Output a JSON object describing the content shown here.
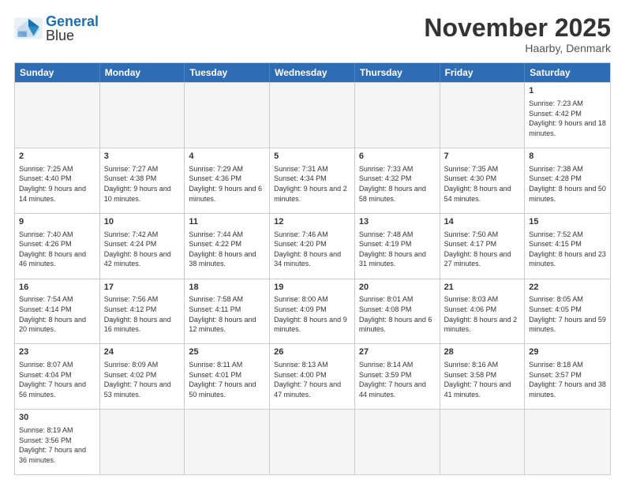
{
  "header": {
    "logo_general": "General",
    "logo_blue": "Blue",
    "month_title": "November 2025",
    "location": "Haarby, Denmark"
  },
  "days_of_week": [
    "Sunday",
    "Monday",
    "Tuesday",
    "Wednesday",
    "Thursday",
    "Friday",
    "Saturday"
  ],
  "weeks": [
    [
      {
        "day": "",
        "empty": true
      },
      {
        "day": "",
        "empty": true
      },
      {
        "day": "",
        "empty": true
      },
      {
        "day": "",
        "empty": true
      },
      {
        "day": "",
        "empty": true
      },
      {
        "day": "",
        "empty": true
      },
      {
        "day": "1",
        "sunrise": "7:23 AM",
        "sunset": "4:42 PM",
        "daylight": "9 hours and 18 minutes."
      }
    ],
    [
      {
        "day": "2",
        "sunrise": "7:25 AM",
        "sunset": "4:40 PM",
        "daylight": "9 hours and 14 minutes."
      },
      {
        "day": "3",
        "sunrise": "7:27 AM",
        "sunset": "4:38 PM",
        "daylight": "9 hours and 10 minutes."
      },
      {
        "day": "4",
        "sunrise": "7:29 AM",
        "sunset": "4:36 PM",
        "daylight": "9 hours and 6 minutes."
      },
      {
        "day": "5",
        "sunrise": "7:31 AM",
        "sunset": "4:34 PM",
        "daylight": "9 hours and 2 minutes."
      },
      {
        "day": "6",
        "sunrise": "7:33 AM",
        "sunset": "4:32 PM",
        "daylight": "8 hours and 58 minutes."
      },
      {
        "day": "7",
        "sunrise": "7:35 AM",
        "sunset": "4:30 PM",
        "daylight": "8 hours and 54 minutes."
      },
      {
        "day": "8",
        "sunrise": "7:38 AM",
        "sunset": "4:28 PM",
        "daylight": "8 hours and 50 minutes."
      }
    ],
    [
      {
        "day": "9",
        "sunrise": "7:40 AM",
        "sunset": "4:26 PM",
        "daylight": "8 hours and 46 minutes."
      },
      {
        "day": "10",
        "sunrise": "7:42 AM",
        "sunset": "4:24 PM",
        "daylight": "8 hours and 42 minutes."
      },
      {
        "day": "11",
        "sunrise": "7:44 AM",
        "sunset": "4:22 PM",
        "daylight": "8 hours and 38 minutes."
      },
      {
        "day": "12",
        "sunrise": "7:46 AM",
        "sunset": "4:20 PM",
        "daylight": "8 hours and 34 minutes."
      },
      {
        "day": "13",
        "sunrise": "7:48 AM",
        "sunset": "4:19 PM",
        "daylight": "8 hours and 31 minutes."
      },
      {
        "day": "14",
        "sunrise": "7:50 AM",
        "sunset": "4:17 PM",
        "daylight": "8 hours and 27 minutes."
      },
      {
        "day": "15",
        "sunrise": "7:52 AM",
        "sunset": "4:15 PM",
        "daylight": "8 hours and 23 minutes."
      }
    ],
    [
      {
        "day": "16",
        "sunrise": "7:54 AM",
        "sunset": "4:14 PM",
        "daylight": "8 hours and 20 minutes."
      },
      {
        "day": "17",
        "sunrise": "7:56 AM",
        "sunset": "4:12 PM",
        "daylight": "8 hours and 16 minutes."
      },
      {
        "day": "18",
        "sunrise": "7:58 AM",
        "sunset": "4:11 PM",
        "daylight": "8 hours and 12 minutes."
      },
      {
        "day": "19",
        "sunrise": "8:00 AM",
        "sunset": "4:09 PM",
        "daylight": "8 hours and 9 minutes."
      },
      {
        "day": "20",
        "sunrise": "8:01 AM",
        "sunset": "4:08 PM",
        "daylight": "8 hours and 6 minutes."
      },
      {
        "day": "21",
        "sunrise": "8:03 AM",
        "sunset": "4:06 PM",
        "daylight": "8 hours and 2 minutes."
      },
      {
        "day": "22",
        "sunrise": "8:05 AM",
        "sunset": "4:05 PM",
        "daylight": "7 hours and 59 minutes."
      }
    ],
    [
      {
        "day": "23",
        "sunrise": "8:07 AM",
        "sunset": "4:04 PM",
        "daylight": "7 hours and 56 minutes."
      },
      {
        "day": "24",
        "sunrise": "8:09 AM",
        "sunset": "4:02 PM",
        "daylight": "7 hours and 53 minutes."
      },
      {
        "day": "25",
        "sunrise": "8:11 AM",
        "sunset": "4:01 PM",
        "daylight": "7 hours and 50 minutes."
      },
      {
        "day": "26",
        "sunrise": "8:13 AM",
        "sunset": "4:00 PM",
        "daylight": "7 hours and 47 minutes."
      },
      {
        "day": "27",
        "sunrise": "8:14 AM",
        "sunset": "3:59 PM",
        "daylight": "7 hours and 44 minutes."
      },
      {
        "day": "28",
        "sunrise": "8:16 AM",
        "sunset": "3:58 PM",
        "daylight": "7 hours and 41 minutes."
      },
      {
        "day": "29",
        "sunrise": "8:18 AM",
        "sunset": "3:57 PM",
        "daylight": "7 hours and 38 minutes."
      }
    ],
    [
      {
        "day": "30",
        "sunrise": "8:19 AM",
        "sunset": "3:56 PM",
        "daylight": "7 hours and 36 minutes."
      },
      {
        "day": "",
        "empty": true
      },
      {
        "day": "",
        "empty": true
      },
      {
        "day": "",
        "empty": true
      },
      {
        "day": "",
        "empty": true
      },
      {
        "day": "",
        "empty": true
      },
      {
        "day": "",
        "empty": true
      }
    ]
  ]
}
